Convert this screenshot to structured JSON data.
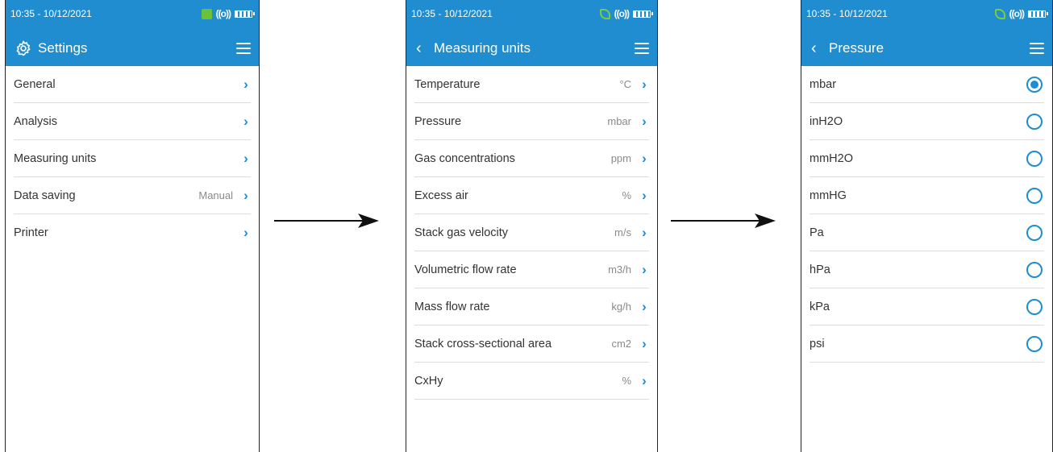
{
  "status": {
    "datetime": "10:35 - 10/12/2021"
  },
  "screen1": {
    "title": "Settings",
    "items": [
      {
        "label": "General",
        "value": ""
      },
      {
        "label": "Analysis",
        "value": ""
      },
      {
        "label": "Measuring units",
        "value": ""
      },
      {
        "label": "Data saving",
        "value": "Manual"
      },
      {
        "label": "Printer",
        "value": ""
      }
    ]
  },
  "screen2": {
    "title": "Measuring units",
    "items": [
      {
        "label": "Temperature",
        "value": "°C"
      },
      {
        "label": "Pressure",
        "value": "mbar"
      },
      {
        "label": "Gas concentrations",
        "value": "ppm"
      },
      {
        "label": "Excess air",
        "value": "%"
      },
      {
        "label": "Stack gas velocity",
        "value": "m/s"
      },
      {
        "label": "Volumetric flow rate",
        "value": "m3/h"
      },
      {
        "label": "Mass flow rate",
        "value": "kg/h"
      },
      {
        "label": "Stack cross-sectional area",
        "value": "cm2"
      },
      {
        "label": "CxHy",
        "value": "%"
      }
    ]
  },
  "screen3": {
    "title": "Pressure",
    "options": [
      {
        "label": "mbar",
        "selected": true
      },
      {
        "label": "inH2O",
        "selected": false
      },
      {
        "label": "mmH2O",
        "selected": false
      },
      {
        "label": "mmHG",
        "selected": false
      },
      {
        "label": "Pa",
        "selected": false
      },
      {
        "label": "hPa",
        "selected": false
      },
      {
        "label": "kPa",
        "selected": false
      },
      {
        "label": "psi",
        "selected": false
      }
    ]
  },
  "colors": {
    "accent": "#1f8dcf",
    "leaf": "#6cc13a"
  },
  "icons": {
    "settings": "gear-icon",
    "back": "chevron-left-icon",
    "menu": "hamburger-menu-icon",
    "row": "chevron-right-icon",
    "radio": "radio-icon",
    "arrow": "arrow-right-icon"
  }
}
